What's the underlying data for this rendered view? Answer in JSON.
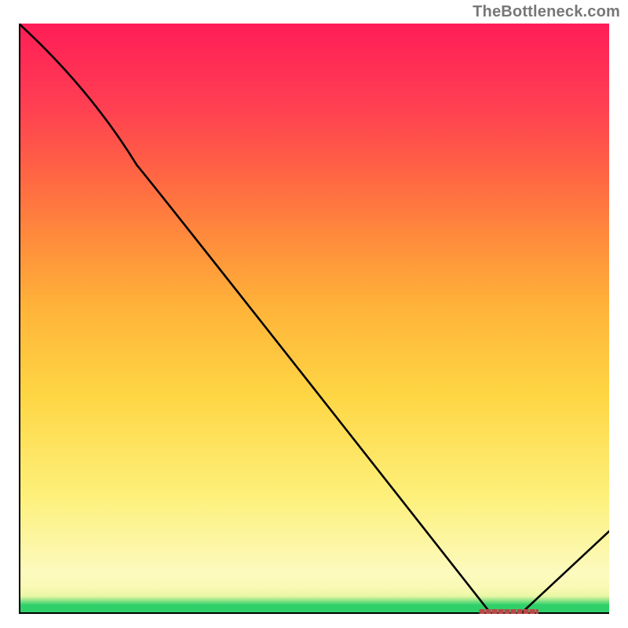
{
  "attribution": "TheBottleneck.com",
  "colors": {
    "curve": "#000000",
    "marker": "#ba4648"
  },
  "chart_data": {
    "type": "line",
    "title": "",
    "xlabel": "",
    "ylabel": "",
    "xlim": [
      0,
      100
    ],
    "ylim": [
      0,
      100
    ],
    "x": [
      0,
      20,
      80,
      85,
      100
    ],
    "values": [
      100,
      76,
      0,
      0,
      14
    ],
    "minimum_band": {
      "x_start": 78,
      "x_end": 88,
      "y": 0
    },
    "notes": "Chart has no visible tick labels or axis titles; gradient background from red (top) through orange/yellow to green (bottom). Curve estimated from pixel positions relative to plot area."
  }
}
